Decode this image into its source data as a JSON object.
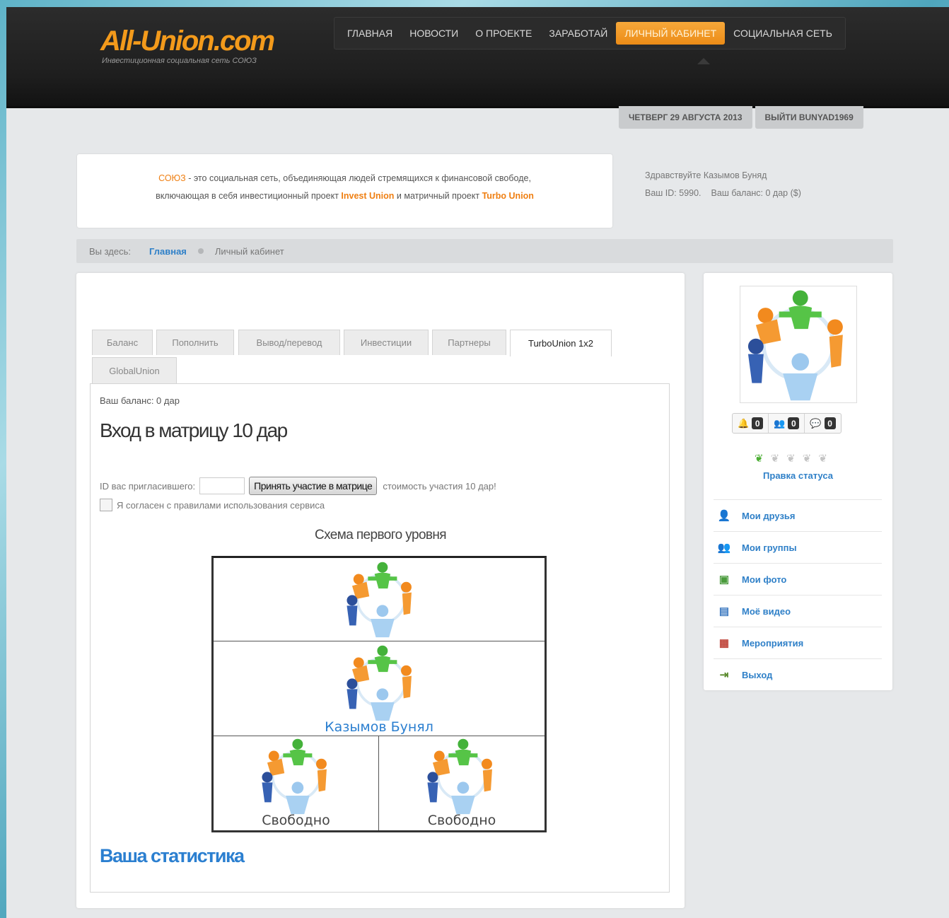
{
  "logo": {
    "main": "All-Union.com",
    "sub": "Инвестиционная социальная сеть СОЮЗ"
  },
  "nav": {
    "items": [
      "Главная",
      "Новости",
      "О проекте",
      "Заработай",
      "Личный кабинет",
      "Социальная сеть"
    ],
    "active": "Личный кабинет"
  },
  "datebar": {
    "date": "ЧЕТВЕРГ 29 АВГУСТА 2013",
    "logout": "ВЫЙТИ BUNYAD1969"
  },
  "intro": {
    "brand": "СОЮЗ",
    "text1": " - это социальная сеть, объединяющая людей стремящихся к финансовой свободе,",
    "text2": "включающая в себя  инвестиционный проект ",
    "invest": "Invest Union",
    "text3": " и матричный проект ",
    "turbo": "Turbo Union"
  },
  "greeting": {
    "hello": "Здравствуйте Казымов Буняд",
    "id": "Ваш ID: 5990.",
    "balance": "Ваш баланс: 0 дар ($)"
  },
  "breadcrumb": {
    "label": "Вы здесь:",
    "home": "Главная",
    "current": "Личный кабинет"
  },
  "tabs": [
    "Баланс",
    "Пополнить",
    "Вывод/перевод",
    "Инвестиции",
    "Партнеры",
    "TurboUnion 1x2",
    "GlobalUnion"
  ],
  "active_tab": "TurboUnion 1x2",
  "panel": {
    "balance": "Ваш баланс: 0 дар",
    "title": "Вход в матрицу 10 дар",
    "ref_label": "ID вас пригласившего:",
    "ref_value": "",
    "join_button": "Принять участие в матрице",
    "cost": "стоимость участия 10 дар!",
    "agree": "Я согласен с правилами использования сервиса",
    "agree_checked": false,
    "scheme_title": "Схема первого уровня",
    "scheme": {
      "top": "",
      "middle": "Казымов Бунял",
      "left": "Свободно",
      "right": "Свободно"
    },
    "stats_title": "Ваша статистика"
  },
  "sidebar": {
    "counters": [
      {
        "icon": "bell-icon",
        "value": "0"
      },
      {
        "icon": "friends-icon",
        "value": "0"
      },
      {
        "icon": "messages-icon",
        "value": "0"
      }
    ],
    "status_link": "Правка статуса",
    "menu": [
      {
        "label": "Мои друзья",
        "icon": "user-icon"
      },
      {
        "label": "Мои группы",
        "icon": "group-icon"
      },
      {
        "label": "Мои фото",
        "icon": "photo-icon"
      },
      {
        "label": "Моё видео",
        "icon": "video-icon"
      },
      {
        "label": "Мероприятия",
        "icon": "calendar-icon"
      },
      {
        "label": "Выход",
        "icon": "exit-icon"
      }
    ]
  },
  "colors": {
    "accent": "#ef7f12",
    "link": "#2f80c8",
    "topbar": "#1e1e1e"
  }
}
